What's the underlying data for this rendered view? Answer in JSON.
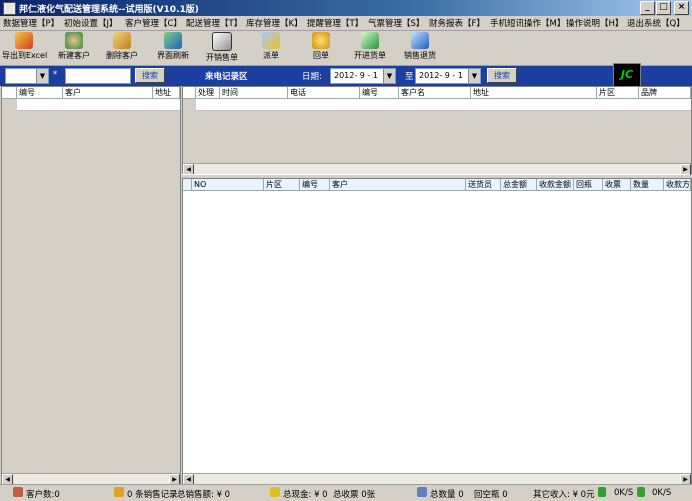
{
  "window": {
    "title": "邦仁液化气配送管理系统--试用版(V10.1版)",
    "min": "_",
    "max": "□",
    "close": "×"
  },
  "menu": [
    "数据管理【P】",
    "初始设置【J】",
    "客户管理【C】",
    "配送管理【T】",
    "库存管理【K】",
    "提醒管理【T】",
    "气票管理【S】",
    "财务报表【F】",
    "手机短讯操作【M】",
    "操作说明【H】",
    "退出系统【Q】"
  ],
  "toolbar": [
    "导出到Excel",
    "新建客户",
    "删除客户",
    "界面刷新",
    "开销售单",
    "派单",
    "回单",
    "开进货单",
    "销售退货"
  ],
  "search": {
    "search1": "搜索",
    "star": "*",
    "call_log": "来电记录区",
    "date_label": "日期:",
    "date_from": "2012- 9 - 1",
    "to_label": "至",
    "date_to": "2012- 9 - 1",
    "search2": "搜索"
  },
  "logo_text": "JC",
  "left_grid": {
    "headers": [
      "编号",
      "客户",
      "地址"
    ]
  },
  "call_grid": {
    "headers": [
      "处理",
      "时间",
      "电话",
      "编号",
      "客户名",
      "地址",
      "片区",
      "品牌"
    ]
  },
  "order_grid": {
    "headers": [
      "NO",
      "片区",
      "编号",
      "客户",
      "送货员",
      "总金额",
      "收款金额",
      "回瓶",
      "收票",
      "数量",
      "收款方"
    ]
  },
  "status": {
    "customers": "客户数:0",
    "sales_records": "0 条销售记录",
    "sales_amount": "总销售额: ¥ 0",
    "cash": "总现金: ¥ 0",
    "tickets": "总收票 0张",
    "qty": "总数量 0",
    "empty": "回空瓶 0",
    "other_income": "其它收入: ¥ 0元",
    "net1": "0K/S",
    "net2": "0K/S"
  }
}
